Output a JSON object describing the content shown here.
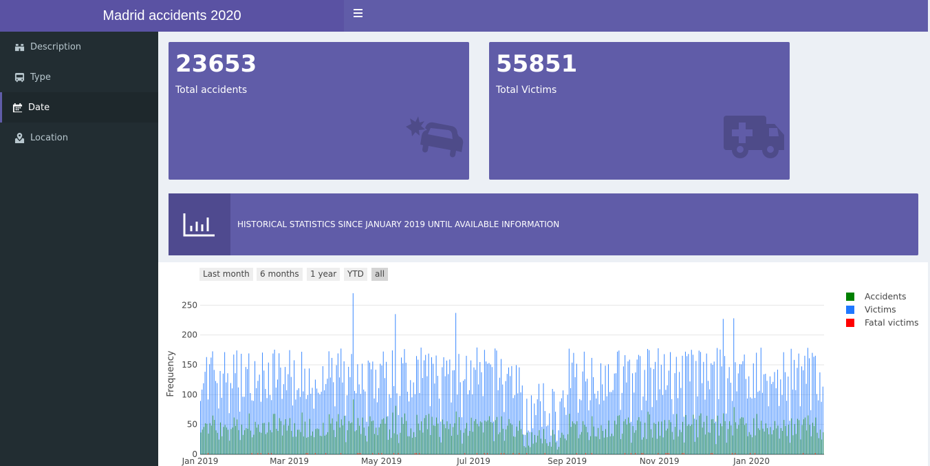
{
  "header": {
    "title": "Madrid accidents 2020"
  },
  "sidebar": {
    "items": [
      {
        "label": "Description",
        "icon": "binoculars-icon"
      },
      {
        "label": "Type",
        "icon": "bus-icon"
      },
      {
        "label": "Date",
        "icon": "calendar-icon"
      },
      {
        "label": "Location",
        "icon": "map-marker-icon"
      }
    ],
    "active": "Date"
  },
  "value_boxes": [
    {
      "value": "23653",
      "label": "Total accidents",
      "icon": "car-crash-icon"
    },
    {
      "value": "55851",
      "label": "Total Victims",
      "icon": "ambulance-icon"
    }
  ],
  "info_box": {
    "text": "HISTORICAL STATISTICS SINCE JANUARY 2019 UNTIL AVAILABLE INFORMATION",
    "icon": "bar-chart-icon"
  },
  "range_buttons": [
    "Last month",
    "6 months",
    "1 year",
    "YTD",
    "all"
  ],
  "colors": {
    "accent": "#605ca8",
    "sidebar": "#222d32",
    "accidents": "#008000",
    "victims": "#1f78ff",
    "fatal": "#ff0000"
  },
  "chart_data": {
    "type": "bar",
    "ylabel": "Frequency",
    "xlim": [
      "2019-01-01",
      "2020-02-18"
    ],
    "ylim": [
      0,
      270
    ],
    "yticks": [
      0,
      50,
      100,
      150,
      200,
      250
    ],
    "xticks": [
      "Jan 2019",
      "Mar 2019",
      "May 2019",
      "Jul 2019",
      "Sep 2019",
      "Nov 2019",
      "Jan 2020"
    ],
    "legend_position": "top-right",
    "grid": true,
    "series": [
      {
        "name": "Accidents",
        "color": "#008000",
        "typical_range": [
          15,
          80
        ]
      },
      {
        "name": "Victims",
        "color": "#1f78ff",
        "typical_range": [
          30,
          200
        ],
        "notable_peaks": [
          {
            "x": "2019-04-12",
            "y": 270
          },
          {
            "x": "2019-05-10",
            "y": 235
          },
          {
            "x": "2019-06-19",
            "y": 237
          },
          {
            "x": "2019-12-13",
            "y": 227
          },
          {
            "x": "2019-12-20",
            "y": 228
          }
        ]
      },
      {
        "name": "Fatal victims",
        "color": "#ff0000",
        "typical_range": [
          0,
          3
        ]
      }
    ]
  }
}
